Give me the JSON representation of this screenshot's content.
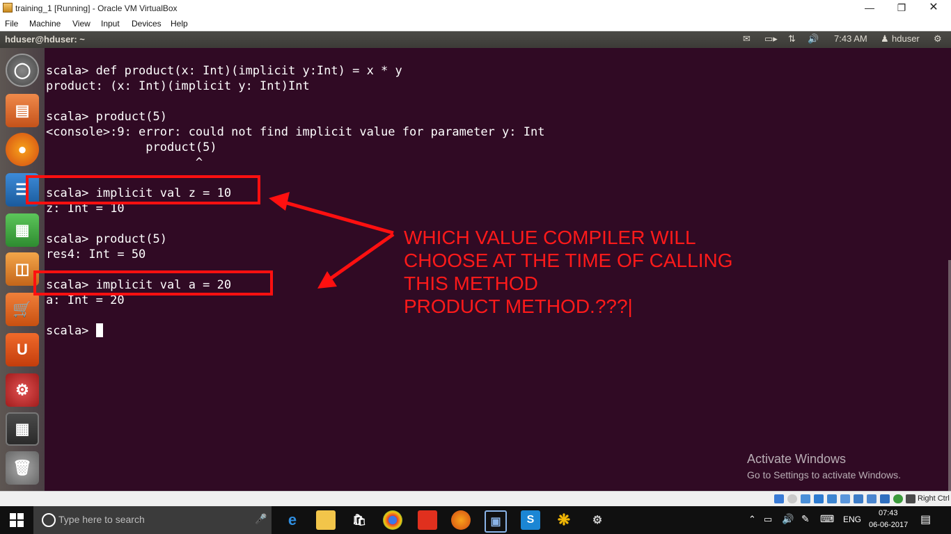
{
  "window": {
    "title": "training_1 [Running] - Oracle VM VirtualBox",
    "minimize_icon": "minimize-icon",
    "maximize_icon": "restore-icon",
    "close_icon": "close-icon"
  },
  "menu": [
    "File",
    "Machine",
    "View",
    "Input",
    "Devices",
    "Help"
  ],
  "ubuntu_panel": {
    "window_title": "hduser@hduser: ~",
    "time": "7:43 AM",
    "user": "hduser",
    "indicators": [
      "mail-icon",
      "battery-icon",
      "network-icon",
      "volume-icon",
      "user-icon",
      "gear-icon"
    ]
  },
  "launcher": [
    "ubuntu-dash-icon",
    "files-icon",
    "firefox-icon",
    "writer-icon",
    "calc-icon",
    "impress-icon",
    "software-center-icon",
    "ubuntu-one-icon",
    "system-settings-icon",
    "workspace-switcher-icon",
    "trash-icon"
  ],
  "terminal": {
    "lines": [
      "scala> def product(x: Int)(implicit y:Int) = x * y",
      "product: (x: Int)(implicit y: Int)Int",
      "",
      "scala> product(5)",
      "<console>:9: error: could not find implicit value for parameter y: Int",
      "              product(5)",
      "                     ^",
      "",
      "scala> implicit val z = 10",
      "z: Int = 10",
      "",
      "scala> product(5)",
      "res4: Int = 50",
      "",
      "scala> implicit val a = 20",
      "a: Int = 20",
      "",
      "scala> "
    ]
  },
  "annotation": {
    "lines": [
      "WHICH VALUE COMPILER WILL",
      "CHOOSE AT THE TIME OF CALLING",
      "THIS METHOD",
      "PRODUCT METHOD.???|"
    ],
    "color": "#ff1a1a"
  },
  "watermark": {
    "title": "Activate Windows",
    "subtitle": "Go to Settings to activate Windows."
  },
  "vbox_status": {
    "host_key": "Right Ctrl"
  },
  "taskbar": {
    "search_placeholder": "Type here to search",
    "language": "ENG",
    "time": "07:43",
    "date": "06-06-2017"
  }
}
